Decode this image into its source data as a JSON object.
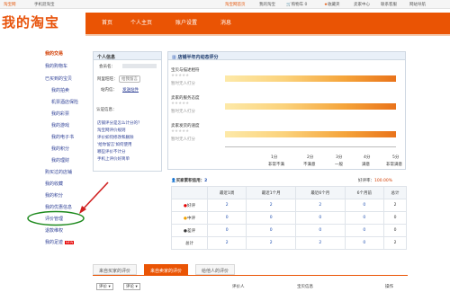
{
  "topbar": {
    "left": [
      "淘宝网",
      "手机逛淘宝"
    ],
    "cart": "购物车 0",
    "favorites": "收藏夹",
    "right": [
      "我的淘宝",
      "卖家中心",
      "联系客服",
      "网站导航"
    ],
    "highlight": "淘宝网首页"
  },
  "brand": {
    "logo": "我的淘宝"
  },
  "nav": {
    "tabs": [
      "首页",
      "个人主页",
      "账户设置",
      "消息"
    ],
    "active_index": 2
  },
  "sidebar": {
    "items": [
      {
        "label": "我的交易",
        "type": "title"
      },
      {
        "label": "我的购物车",
        "type": "item"
      },
      {
        "label": "已买到的宝贝",
        "type": "item"
      },
      {
        "label": "我的拍卖",
        "type": "sub"
      },
      {
        "label": "机票酒店保险",
        "type": "sub"
      },
      {
        "label": "我的彩票",
        "type": "sub"
      },
      {
        "label": "我的游戏",
        "type": "sub"
      },
      {
        "label": "我的电子书",
        "type": "sub"
      },
      {
        "label": "我的积分",
        "type": "sub"
      },
      {
        "label": "我的理财",
        "type": "sub"
      },
      {
        "label": "购买过的店铺",
        "type": "item"
      },
      {
        "label": "我的收藏",
        "type": "item"
      },
      {
        "label": "我的积分",
        "type": "item"
      },
      {
        "label": "我的优惠信息",
        "type": "item"
      },
      {
        "label": "评价管理",
        "type": "item"
      },
      {
        "label": "退款维权",
        "type": "item"
      },
      {
        "label": "我的足迹",
        "type": "item",
        "badge": "NEW"
      }
    ]
  },
  "personal": {
    "title": "个人信息",
    "member_label": "会员名：",
    "aliwangwang_label": "阿里旺旺：",
    "aliwangwang_value": "给我留言",
    "site_label": "站内信：",
    "site_value": "发送站件",
    "cert_label": "认证信息：",
    "links": [
      "店铺评分是怎么计分的？",
      "淘宝网评价规则",
      "评价如何修改和删除",
      "'给你留言'如何使用",
      "哪些评价不计分",
      "手机上评价好简单"
    ]
  },
  "dsr": {
    "title": "店铺半年内动态评分",
    "rows": [
      {
        "label": "宝贝与描述相符",
        "note": "暂时无人打分"
      },
      {
        "label": "卖家的服务态度",
        "note": "暂时无人打分"
      },
      {
        "label": "卖家发货的速度",
        "note": "暂时无人打分"
      }
    ],
    "scale": [
      {
        "num": "1分",
        "word": "非常不满"
      },
      {
        "num": "2分",
        "word": "不满意"
      },
      {
        "num": "3分",
        "word": "一般"
      },
      {
        "num": "4分",
        "word": "满意"
      },
      {
        "num": "5分",
        "word": "非常满意"
      }
    ]
  },
  "credit": {
    "title": "买家累积信用：",
    "score": "2",
    "rate_label": "好评率：",
    "rate_value": "100.00%",
    "headers": [
      "",
      "最近1周",
      "最近1个月",
      "最近6个月",
      "6个月前",
      "总计"
    ],
    "rows": [
      {
        "label": "好评",
        "values": [
          "2",
          "2",
          "2",
          "0",
          "2"
        ]
      },
      {
        "label": "中评",
        "values": [
          "0",
          "0",
          "0",
          "0",
          "0"
        ]
      },
      {
        "label": "差评",
        "values": [
          "0",
          "0",
          "0",
          "0",
          "0"
        ]
      },
      {
        "label": "总计",
        "values": [
          "2",
          "2",
          "2",
          "0",
          "2"
        ]
      }
    ]
  },
  "bottom_tabs": [
    "来自买家的评价",
    "来自卖家的评价",
    "给他人的评价"
  ],
  "bottom_active": 1,
  "filters": {
    "select1": "评价",
    "select2": "评论",
    "col_rater": "评价人",
    "col_item": "宝贝信息",
    "col_action": "操作"
  },
  "colors": {
    "accent": "#ea5404",
    "link": "#2c3e95",
    "annotation": "#1e8a1e"
  }
}
